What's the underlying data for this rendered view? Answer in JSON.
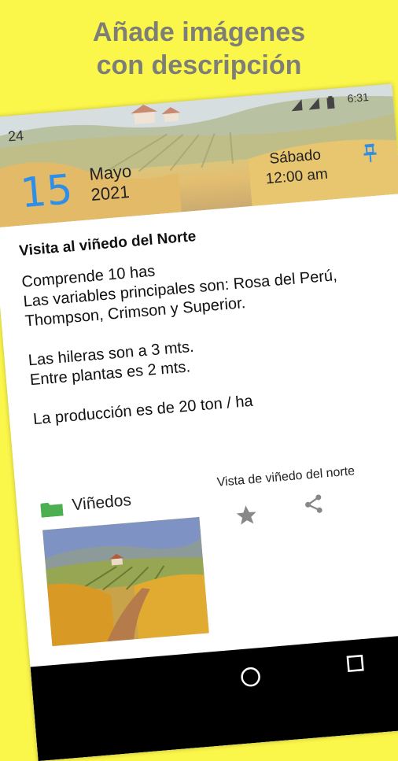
{
  "headline": {
    "line1": "Añade imágenes",
    "line2": "con descripción"
  },
  "status_bar": {
    "time": "6:31",
    "icons": [
      "signal-icon",
      "signal-icon",
      "battery-icon"
    ]
  },
  "note_header": {
    "count": "24",
    "day": "15",
    "month": "Mayo",
    "year": "2021",
    "weekday": "Sábado",
    "time": "12:00 am"
  },
  "note": {
    "title": "Visita al viñedo del Norte",
    "body": "Comprende 10 has\nLas variables principales son:  Rosa del Perú, Thompson, Crimson y Superior.\n\nLas hileras son a 3 mts.\nEntre plantas es 2 mts.\n\nLa producción es de 20 ton / ha",
    "category": "Viñedos",
    "image_caption": "Vista de viñedo del norte"
  },
  "colors": {
    "background": "#fbf64a",
    "accent": "#2f8fe8",
    "folder": "#4caf50",
    "headline_text": "#7e7e78"
  }
}
